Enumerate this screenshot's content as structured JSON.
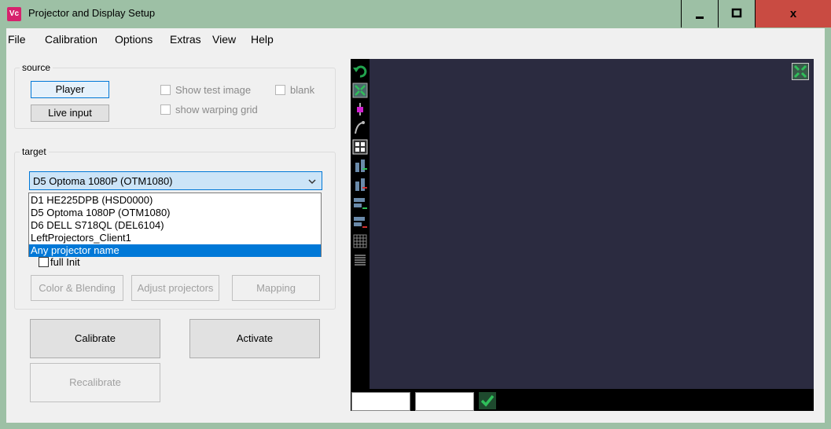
{
  "titlebar": {
    "logo_text": "Vc",
    "title": "Projector and Display Setup",
    "minimize_icon": "minimize-icon",
    "maximize_icon": "maximize-icon",
    "close_label": "x"
  },
  "menu": [
    "File",
    "Calibration",
    "Options",
    "Extras",
    "View",
    "Help"
  ],
  "source": {
    "label": "source",
    "player": "Player",
    "live_input": "Live input",
    "show_test_image": "Show test image",
    "blank": "blank",
    "show_warping_grid": "show warping grid"
  },
  "target": {
    "label": "target",
    "selected": "D5 Optoma 1080P (OTM1080)",
    "options": [
      "D1 HE225DPB (HSD0000)",
      "D5 Optoma 1080P (OTM1080)",
      "D6 DELL S718QL (DEL6104)",
      "LeftProjectors_Client1",
      "Any projector name"
    ],
    "highlighted_index": 4,
    "full_init": "full Init",
    "color_blending": "Color & Blending",
    "adjust_projectors": "Adjust projectors",
    "mapping": "Mapping"
  },
  "actions": {
    "calibrate": "Calibrate",
    "activate": "Activate",
    "recalibrate": "Recalibrate"
  },
  "preview": {
    "tools": [
      "undo-icon",
      "fit-view-icon",
      "pin-icon",
      "curve-icon",
      "grid-4-icon",
      "add-column-icon",
      "remove-column-icon",
      "add-row-icon",
      "remove-row-icon",
      "dense-grid-icon",
      "lines-icon"
    ],
    "fullscreen_icon": "fullscreen-icon",
    "confirm_icon": "check-icon",
    "field1_value": "",
    "field2_value": ""
  },
  "colors": {
    "titlebar_bg": "#9dc0a5",
    "close_bg": "#c94b42",
    "preview_bg": "#2b2b40",
    "selection": "#0078d7"
  }
}
